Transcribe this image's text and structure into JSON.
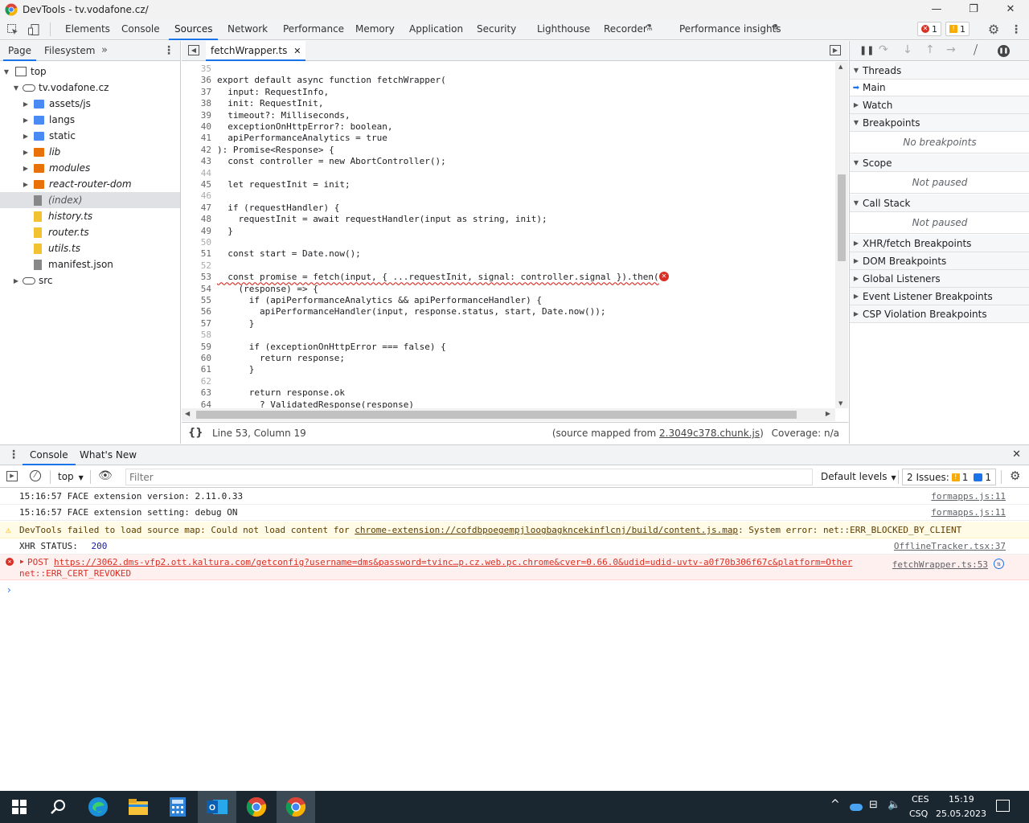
{
  "window": {
    "title": "DevTools - tv.vodafone.cz/"
  },
  "main_tabs": [
    "Elements",
    "Console",
    "Sources",
    "Network",
    "Performance",
    "Memory",
    "Application",
    "Security",
    "Lighthouse",
    "Recorder",
    "Performance insights"
  ],
  "badges": {
    "errors": "1",
    "warnings": "1"
  },
  "navigator": {
    "tabs": [
      "Page",
      "Filesystem"
    ],
    "tree": [
      {
        "label": "top"
      },
      {
        "label": "tv.vodafone.cz"
      },
      {
        "label": "assets/js"
      },
      {
        "label": "langs"
      },
      {
        "label": "static"
      },
      {
        "label": "lib"
      },
      {
        "label": "modules"
      },
      {
        "label": "react-router-dom"
      },
      {
        "label": "(index)"
      },
      {
        "label": "history.ts"
      },
      {
        "label": "router.ts"
      },
      {
        "label": "utils.ts"
      },
      {
        "label": "manifest.json"
      },
      {
        "label": "src"
      }
    ]
  },
  "editor": {
    "tab": "fetchWrapper.ts",
    "lines": [
      {
        "n": "35",
        "t": ""
      },
      {
        "n": "36",
        "t": "export default async function fetchWrapper("
      },
      {
        "n": "37",
        "t": "  input: RequestInfo,"
      },
      {
        "n": "38",
        "t": "  init: RequestInit,"
      },
      {
        "n": "39",
        "t": "  timeout?: Milliseconds,"
      },
      {
        "n": "40",
        "t": "  exceptionOnHttpError?: boolean,"
      },
      {
        "n": "41",
        "t": "  apiPerformanceAnalytics = true"
      },
      {
        "n": "42",
        "t": "): Promise<Response> {"
      },
      {
        "n": "43",
        "t": "  const controller = new AbortController();"
      },
      {
        "n": "44",
        "t": ""
      },
      {
        "n": "45",
        "t": "  let requestInit = init;"
      },
      {
        "n": "46",
        "t": ""
      },
      {
        "n": "47",
        "t": "  if (requestHandler) {"
      },
      {
        "n": "48",
        "t": "    requestInit = await requestHandler(input as string, init);"
      },
      {
        "n": "49",
        "t": "  }"
      },
      {
        "n": "50",
        "t": ""
      },
      {
        "n": "51",
        "t": "  const start = Date.now();"
      },
      {
        "n": "52",
        "t": ""
      },
      {
        "n": "53",
        "t": "  const promise = fetch(input, { ...requestInit, signal: controller.signal }).then("
      },
      {
        "n": "54",
        "t": "    (response) => {"
      },
      {
        "n": "55",
        "t": "      if (apiPerformanceAnalytics && apiPerformanceHandler) {"
      },
      {
        "n": "56",
        "t": "        apiPerformanceHandler(input, response.status, start, Date.now());"
      },
      {
        "n": "57",
        "t": "      }"
      },
      {
        "n": "58",
        "t": ""
      },
      {
        "n": "59",
        "t": "      if (exceptionOnHttpError === false) {"
      },
      {
        "n": "60",
        "t": "        return response;"
      },
      {
        "n": "61",
        "t": "      }"
      },
      {
        "n": "62",
        "t": ""
      },
      {
        "n": "63",
        "t": "      return response.ok"
      },
      {
        "n": "64",
        "t": "        ? ValidatedResponse(response)"
      }
    ],
    "status_position": "Line 53, Column 19",
    "status_source_prefix": "(source mapped from ",
    "status_source_link": "2.3049c378.chunk.js",
    "status_source_suffix": ")",
    "status_coverage": "Coverage: n/a"
  },
  "debugger": {
    "threads": "Threads",
    "thread_main": "Main",
    "watch": "Watch",
    "breakpoints": "Breakpoints",
    "no_breakpoints": "No breakpoints",
    "scope": "Scope",
    "scope_body": "Not paused",
    "call_stack": "Call Stack",
    "call_stack_body": "Not paused",
    "xhr": "XHR/fetch Breakpoints",
    "dom": "DOM Breakpoints",
    "global": "Global Listeners",
    "event": "Event Listener Breakpoints",
    "csp": "CSP Violation Breakpoints"
  },
  "drawer": {
    "tabs": [
      "Console",
      "What's New"
    ],
    "context": "top",
    "filter_placeholder": "Filter",
    "levels": "Default levels",
    "issues_label": "2 Issues:",
    "issues_warn": "1",
    "issues_info": "1"
  },
  "console": [
    {
      "type": "log",
      "text": "15:16:57 FACE extension version: 2.11.0.33",
      "src": "formapps.js:11"
    },
    {
      "type": "log",
      "text": "15:16:57 FACE extension setting: debug ON",
      "src": "formapps.js:11"
    },
    {
      "type": "warn",
      "prefix": "DevTools failed to load source map: Could not load content for ",
      "link": "chrome-extension://cofdbpoegempjloogbagkncekinflcnj/build/content.js.map",
      "suffix": ": System error: net::ERR_BLOCKED_BY_CLIENT"
    },
    {
      "type": "log",
      "label": "XHR STATUS:",
      "value": "200",
      "src": "OfflineTracker.tsx:37"
    },
    {
      "type": "error",
      "method": "POST",
      "url": "https://3062.dms-vfp2.ott.kaltura.com/getconfig?username=dms&password=tvinc…p.cz.web.pc.chrome&cver=0.66.0&udid=udid-uvtv-a0f70b306f67c&platform=Other",
      "line2": "net::ERR_CERT_REVOKED",
      "src": "fetchWrapper.ts:53"
    }
  ],
  "taskbar": {
    "lang_top": "CES",
    "lang_bottom": "CSQ",
    "time": "15:19",
    "date": "25.05.2023"
  }
}
